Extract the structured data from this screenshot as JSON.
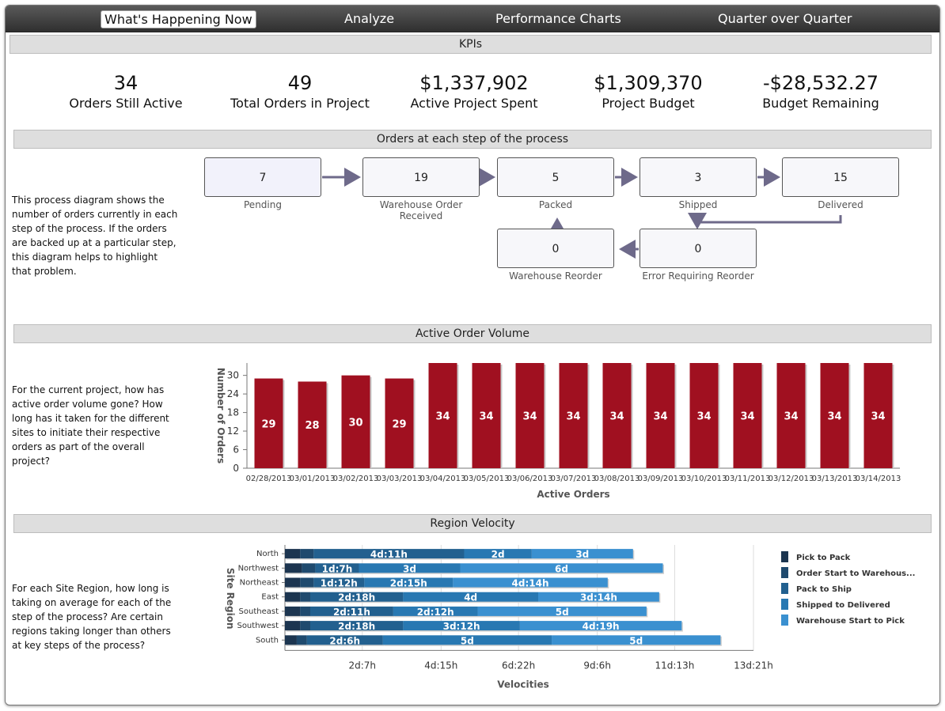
{
  "nav": {
    "tabs": [
      {
        "label": "What's Happening Now",
        "active": true
      },
      {
        "label": "Analyze",
        "active": false
      },
      {
        "label": "Performance Charts",
        "active": false
      },
      {
        "label": "Quarter over Quarter",
        "active": false
      }
    ]
  },
  "kpis": {
    "title": "KPIs",
    "items": [
      {
        "value": "34",
        "label": "Orders Still Active"
      },
      {
        "value": "49",
        "label": "Total Orders in Project"
      },
      {
        "value": "$1,337,902",
        "label": "Active Project Spent"
      },
      {
        "value": "$1,309,370",
        "label": "Project Budget"
      },
      {
        "value": "-$28,532.27",
        "label": "Budget Remaining"
      }
    ]
  },
  "process": {
    "title": "Orders at each step of the process",
    "description": "This process diagram shows the number of orders currently in each step of the process. If the orders are backed up at a particular step, this diagram helps to highlight that problem.",
    "steps": [
      {
        "count": "7",
        "label": "Pending"
      },
      {
        "count": "19",
        "label": "Warehouse Order Received"
      },
      {
        "count": "5",
        "label": "Packed"
      },
      {
        "count": "3",
        "label": "Shipped"
      },
      {
        "count": "15",
        "label": "Delivered"
      },
      {
        "count": "0",
        "label": "Warehouse Reorder"
      },
      {
        "count": "0",
        "label": "Error Requiring Reorder"
      }
    ]
  },
  "volume": {
    "title": "Active Order Volume",
    "description": "For the current project, how has active order volume gone? How long has it taken for the different sites to initiate their respective orders as part of the overall project?"
  },
  "velocity": {
    "title": "Region Velocity",
    "description": "For each Site Region, how long is taking on average for each of the step of the process? Are certain regions taking longer than others at key steps of the process?"
  },
  "colors": {
    "bar": "#a01020",
    "velocity": [
      "#1c3550",
      "#1f4a6e",
      "#22608f",
      "#2878b2",
      "#3a90d0"
    ]
  },
  "chart_data": [
    {
      "type": "bar",
      "title": "",
      "xlabel": "Active Orders",
      "ylabel": "Number of Orders",
      "ylim": [
        0,
        34
      ],
      "yticks": [
        "0",
        "6",
        "12",
        "18",
        "24",
        "30"
      ],
      "categories": [
        "02/28/2013",
        "03/01/2013",
        "03/02/2013",
        "03/03/2013",
        "03/04/2013",
        "03/05/2013",
        "03/06/2013",
        "03/07/2013",
        "03/08/2013",
        "03/09/2013",
        "03/10/2013",
        "03/11/2013",
        "03/12/2013",
        "03/13/2013",
        "03/14/2013"
      ],
      "values": [
        29,
        28,
        30,
        29,
        34,
        34,
        34,
        34,
        34,
        34,
        34,
        34,
        34,
        34,
        34
      ],
      "data_labels": [
        "29",
        "28",
        "30",
        "29",
        "34",
        "34",
        "34",
        "34",
        "34",
        "34",
        "34",
        "34",
        "34",
        "34",
        "34"
      ],
      "grid": false
    },
    {
      "type": "bar",
      "orientation": "horizontal",
      "stacked": true,
      "title": "",
      "xlabel": "Velocities",
      "ylabel": "Site Region",
      "xlim_days": [
        0,
        13.875
      ],
      "xticks": [
        {
          "label": "2d:7h",
          "days": 2.2917
        },
        {
          "label": "4d:15h",
          "days": 4.625
        },
        {
          "label": "6d:22h",
          "days": 6.9167
        },
        {
          "label": "9d:6h",
          "days": 9.25
        },
        {
          "label": "11d:13h",
          "days": 11.5417
        },
        {
          "label": "13d:21h",
          "days": 13.875
        }
      ],
      "categories": [
        "North",
        "Northwest",
        "Northeast",
        "East",
        "Southeast",
        "Southwest",
        "South"
      ],
      "legend": "right",
      "series": [
        {
          "name": "Pick to Pack",
          "values": [
            0.45,
            0.5,
            0.45,
            0.45,
            0.45,
            0.45,
            0.35
          ],
          "labels": [
            "",
            "",
            "",
            "",
            "",
            "",
            ""
          ]
        },
        {
          "name": "Order Start to Warehous...",
          "values": [
            0.4,
            0.4,
            0.4,
            0.3,
            0.3,
            0.3,
            0.3
          ],
          "labels": [
            "",
            "",
            "",
            "",
            "",
            "",
            ""
          ]
        },
        {
          "name": "Pack to Ship",
          "values": [
            4.458,
            1.292,
            1.5,
            2.75,
            2.458,
            2.75,
            2.25
          ],
          "labels": [
            "4d:11h",
            "1d:7h",
            "1d:12h",
            "2d:18h",
            "2d:11h",
            "2d:18h",
            "2d:6h"
          ]
        },
        {
          "name": "Shipped to Delivered",
          "values": [
            2.0,
            3.0,
            2.625,
            4.0,
            2.5,
            3.458,
            5.0
          ],
          "labels": [
            "2d",
            "3d",
            "2d:15h",
            "4d",
            "2d:12h",
            "3d:12h",
            "5d"
          ]
        },
        {
          "name": "Warehouse Start to Pick",
          "values": [
            3.0,
            6.0,
            4.583,
            3.583,
            5.0,
            4.792,
            5.0
          ],
          "labels": [
            "3d",
            "6d",
            "4d:14h",
            "3d:14h",
            "5d",
            "4d:19h",
            "5d"
          ]
        }
      ]
    }
  ]
}
